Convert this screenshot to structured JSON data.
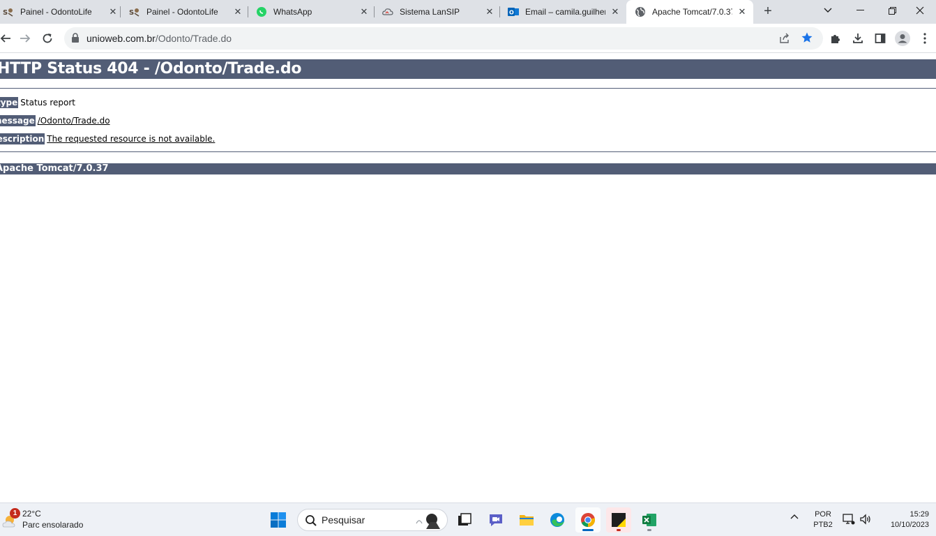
{
  "browser": {
    "tabs": [
      {
        "title": "Painel - OdontoLife",
        "favicon": "odontolife-icon"
      },
      {
        "title": "Painel - OdontoLife",
        "favicon": "odontolife-icon"
      },
      {
        "title": "WhatsApp",
        "favicon": "whatsapp-icon"
      },
      {
        "title": "Sistema LanSIP",
        "favicon": "cloud-icon"
      },
      {
        "title": "Email – camila.guilher",
        "favicon": "outlook-icon"
      },
      {
        "title": "Apache Tomcat/7.0.37",
        "favicon": "globe-icon",
        "active": true
      }
    ],
    "url_host": "unioweb.com.br",
    "url_path": "/Odonto/Trade.do",
    "accent_color": "#1a73e8"
  },
  "page": {
    "heading": "HTTP Status 404 - /Odonto/Trade.do",
    "type_label": "type",
    "type_value": "Status report",
    "message_label": "message",
    "message_value": "/Odonto/Trade.do",
    "description_label": "description",
    "description_value": "The requested resource is not available.",
    "footer": "Apache Tomcat/7.0.37",
    "header_bg_color": "#525d76"
  },
  "taskbar": {
    "weather_badge": "1",
    "weather_temp": "22°C",
    "weather_condition": "Parc ensolarado",
    "search_placeholder": "Pesquisar",
    "lang_line1": "POR",
    "lang_line2": "PTB2",
    "time": "15:29",
    "date": "10/10/2023"
  }
}
